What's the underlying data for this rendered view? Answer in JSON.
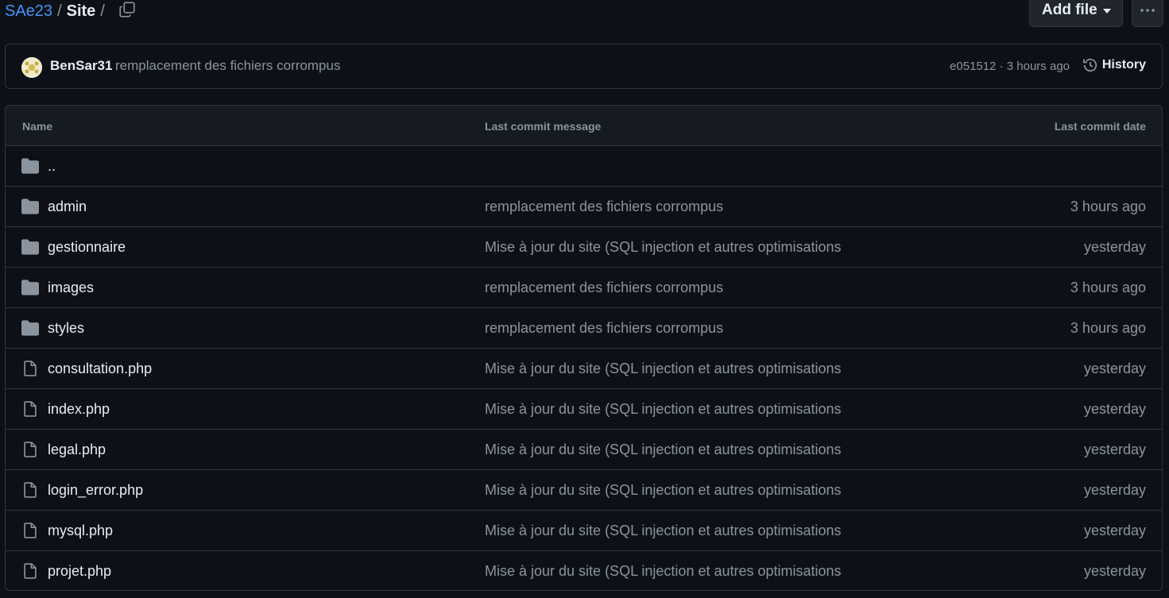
{
  "breadcrumb": {
    "repo": "SAe23",
    "separator": "/",
    "current": "Site",
    "trailing": "/"
  },
  "toolbar": {
    "add_file_label": "Add file",
    "copy_icon": "copy-icon",
    "more_icon": "kebab-horizontal-icon"
  },
  "commit": {
    "author": "BenSar31",
    "message": "remplacement des fichiers corrompus",
    "meta": "e051512 · 3 hours ago",
    "history_label": "History"
  },
  "table": {
    "headers": {
      "name": "Name",
      "message": "Last commit message",
      "date": "Last commit date"
    },
    "rows": [
      {
        "type": "folder",
        "name": "..",
        "message": "",
        "date": ""
      },
      {
        "type": "folder",
        "name": "admin",
        "message": "remplacement des fichiers corrompus",
        "date": "3 hours ago"
      },
      {
        "type": "folder",
        "name": "gestionnaire",
        "message": "Mise à jour du site (SQL injection et autres optimisations",
        "date": "yesterday"
      },
      {
        "type": "folder",
        "name": "images",
        "message": "remplacement des fichiers corrompus",
        "date": "3 hours ago"
      },
      {
        "type": "folder",
        "name": "styles",
        "message": "remplacement des fichiers corrompus",
        "date": "3 hours ago"
      },
      {
        "type": "file",
        "name": "consultation.php",
        "message": "Mise à jour du site (SQL injection et autres optimisations",
        "date": "yesterday"
      },
      {
        "type": "file",
        "name": "index.php",
        "message": "Mise à jour du site (SQL injection et autres optimisations",
        "date": "yesterday"
      },
      {
        "type": "file",
        "name": "legal.php",
        "message": "Mise à jour du site (SQL injection et autres optimisations",
        "date": "yesterday"
      },
      {
        "type": "file",
        "name": "login_error.php",
        "message": "Mise à jour du site (SQL injection et autres optimisations",
        "date": "yesterday"
      },
      {
        "type": "file",
        "name": "mysql.php",
        "message": "Mise à jour du site (SQL injection et autres optimisations",
        "date": "yesterday"
      },
      {
        "type": "file",
        "name": "projet.php",
        "message": "Mise à jour du site (SQL injection et autres optimisations",
        "date": "yesterday"
      }
    ]
  },
  "colors": {
    "background": "#0d1117",
    "link": "#4493f8",
    "muted": "#8b949e",
    "border": "#30363d",
    "text": "#e6edf3"
  }
}
